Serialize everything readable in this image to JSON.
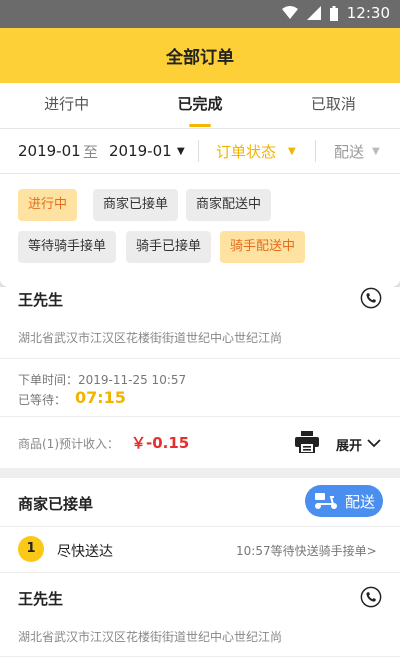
{
  "status_bar": {
    "time": "12:30"
  },
  "app_bar": {
    "title": "全部订单"
  },
  "tabs": [
    {
      "label": "进行中",
      "active": false
    },
    {
      "label": "已完成",
      "active": true
    },
    {
      "label": "已取消",
      "active": false
    }
  ],
  "filters": {
    "start_date": "2019-01",
    "to_label": "至",
    "end_date": "2019-01",
    "status_label": "订单状态",
    "delivery_label": "配送"
  },
  "status_chips": [
    {
      "label": "进行中",
      "selected": true
    },
    {
      "label": "商家已接单",
      "selected": false
    },
    {
      "label": "商家配送中",
      "selected": false
    },
    {
      "label": "等待骑手接单",
      "selected": false
    },
    {
      "label": "骑手已接单",
      "selected": false
    },
    {
      "label": "骑手配送中",
      "selected": true
    }
  ],
  "order1": {
    "customer_name": "王先生",
    "address": "湖北省武汉市江汉区花楼街街道世纪中心世纪江尚",
    "order_time": "下单时间：2019-11-25 10:57",
    "wait_label": "已等待：",
    "wait_time": "07:15",
    "income_label": "商品(1)预计收入：",
    "income_value": "￥-0.15",
    "expand_label": "展开"
  },
  "order2": {
    "status": "商家已接单",
    "deliver_button": "配送",
    "seq_number": "1",
    "delivery_mode": "尽快送达",
    "dispatch_note": "10:57等待快送骑手接单>",
    "customer_name": "王先生",
    "address": "湖北省武汉市江汉区花楼街街道世纪中心世纪江尚"
  },
  "colors": {
    "accent_yellow": "#fcd036",
    "selected_chip_bg": "#fde2a2",
    "selected_chip_text": "#e56d1b",
    "money_red": "#e52f2f",
    "deliver_blue": "#4a8ff0"
  }
}
